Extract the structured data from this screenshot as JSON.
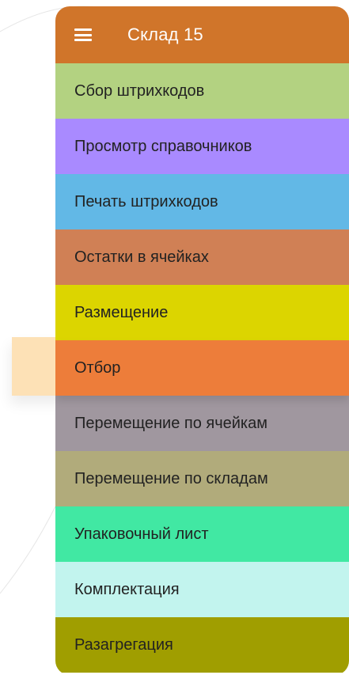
{
  "appbar": {
    "title": "Склад 15",
    "menu_icon": "hamburger-menu-icon",
    "color": "#d0752a"
  },
  "menu": {
    "items": [
      {
        "label": "Сбор штрихкодов",
        "color": "#b3d281"
      },
      {
        "label": "Просмотр справочников",
        "color": "#a98aff"
      },
      {
        "label": "Печать штрихкодов",
        "color": "#62b8e6"
      },
      {
        "label": "Остатки в ячейках",
        "color": "#d08055"
      },
      {
        "label": "Размещение",
        "color": "#dcd500"
      },
      {
        "label": "Отбор",
        "color": "#ed7d3a",
        "selected": true
      },
      {
        "label": "Перемещение по ячейкам",
        "color": "#a0979f"
      },
      {
        "label": "Перемещение по складам",
        "color": "#b1ab7b"
      },
      {
        "label": "Упаковочный лист",
        "color": "#41e8a3"
      },
      {
        "label": "Комплектация",
        "color": "#c2f4ee"
      },
      {
        "label": "Разагрегация",
        "color": "#a09e00"
      }
    ]
  },
  "selection_highlight_color": "#fde1b6"
}
